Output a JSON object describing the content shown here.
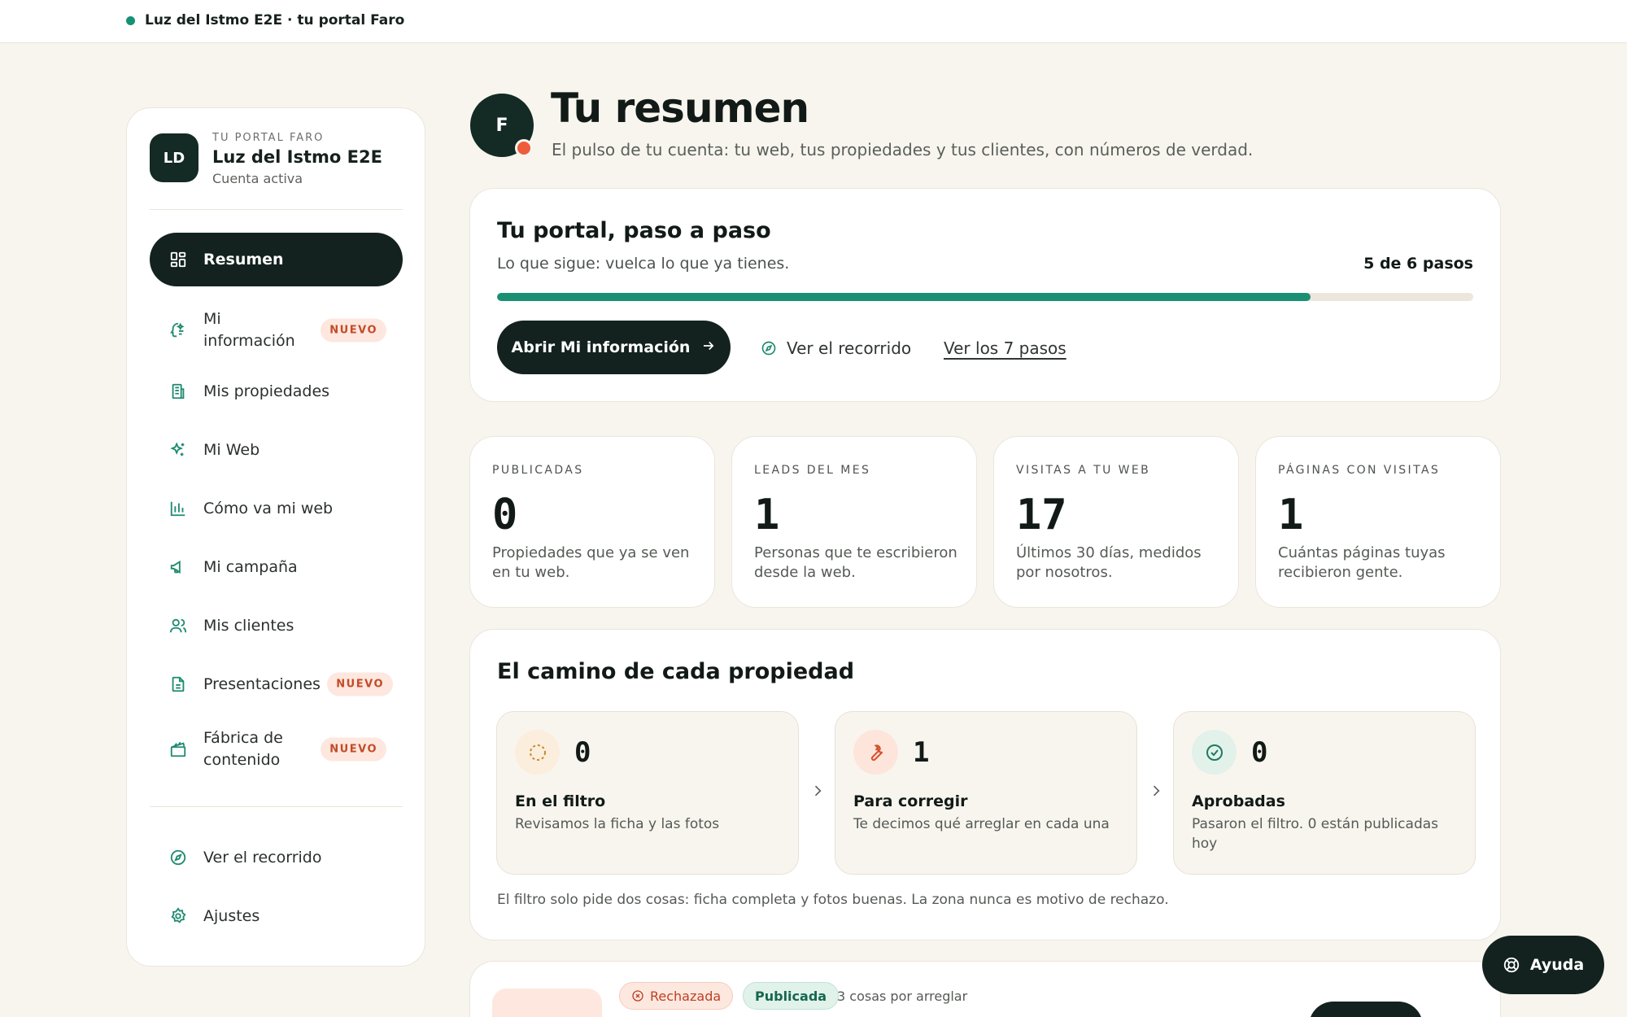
{
  "topbar": {
    "title": "Luz del Istmo E2E · tu portal Faro"
  },
  "account": {
    "initials": "LD",
    "eyebrow": "TU PORTAL FARO",
    "name": "Luz del Istmo E2E",
    "status": "Cuenta activa"
  },
  "nav": {
    "items": [
      {
        "label": "Resumen",
        "icon": "grid-icon",
        "active": true
      },
      {
        "label": "Mi información",
        "icon": "sparkle-face-icon",
        "badge": "NUEVO"
      },
      {
        "label": "Mis propiedades",
        "icon": "building-icon"
      },
      {
        "label": "Mi Web",
        "icon": "sparkles-icon"
      },
      {
        "label": "Cómo va mi web",
        "icon": "bar-chart-icon"
      },
      {
        "label": "Mi campaña",
        "icon": "megaphone-icon"
      },
      {
        "label": "Mis clientes",
        "icon": "users-icon"
      },
      {
        "label": "Presentaciones",
        "icon": "document-icon",
        "badge": "NUEVO"
      },
      {
        "label": "Fábrica de contenido",
        "icon": "clapperboard-icon",
        "badge": "NUEVO"
      }
    ],
    "footer": [
      {
        "label": "Ver el recorrido",
        "icon": "compass-icon"
      },
      {
        "label": "Ajustes",
        "icon": "gear-icon"
      }
    ]
  },
  "header": {
    "avatar_initial": "F",
    "title": "Tu resumen",
    "subtitle": "El pulso de tu cuenta: tu web, tus propiedades y tus clientes, con números de verdad."
  },
  "steps": {
    "title": "Tu portal, paso a paso",
    "subtitle": "Lo que sigue: vuelca lo que ya tienes.",
    "count_label": "5 de 6 pasos",
    "progress": 0.833,
    "cta": "Abrir Mi información",
    "tour_link": "Ver el recorrido",
    "all_steps_link": "Ver los 7 pasos"
  },
  "stats": [
    {
      "label": "PUBLICADAS",
      "value": "0",
      "desc": "Propiedades que ya se ven en tu web."
    },
    {
      "label": "LEADS DEL MES",
      "value": "1",
      "desc": "Personas que te escribieron desde la web."
    },
    {
      "label": "VISITAS A TU WEB",
      "value": "17",
      "desc": "Últimos 30 días, medidos por nosotros."
    },
    {
      "label": "PÁGINAS CON VISITAS",
      "value": "1",
      "desc": "Cuántas páginas tuyas recibieron gente."
    }
  ],
  "pipeline": {
    "title": "El camino de cada propiedad",
    "stages": [
      {
        "count": "0",
        "name": "En el filtro",
        "desc": "Revisamos la ficha y las fotos",
        "icon": "dashed-circle-icon",
        "color": "#fbeedd"
      },
      {
        "count": "1",
        "name": "Para corregir",
        "desc": "Te decimos qué arreglar en cada una",
        "icon": "wrench-icon",
        "color": "#fde5dc"
      },
      {
        "count": "0",
        "name": "Aprobadas",
        "desc": "Pasaron el filtro. 0 están publicadas hoy",
        "icon": "check-circle-icon",
        "color": "#e2f1ea"
      }
    ],
    "note": "El filtro solo pide dos cosas: ficha completa y fotos buenas. La zona nunca es motivo de rechazo."
  },
  "property_preview": {
    "status_rejected": "Rechazada",
    "status_published": "Publicada",
    "issues": "3 cosas por arreglar"
  },
  "help": {
    "label": "Ayuda"
  },
  "colors": {
    "brand_dark": "#13221e",
    "accent_green": "#1a8f73",
    "badge_red": "#c24b28",
    "alert_dot": "#ee5d3b"
  }
}
